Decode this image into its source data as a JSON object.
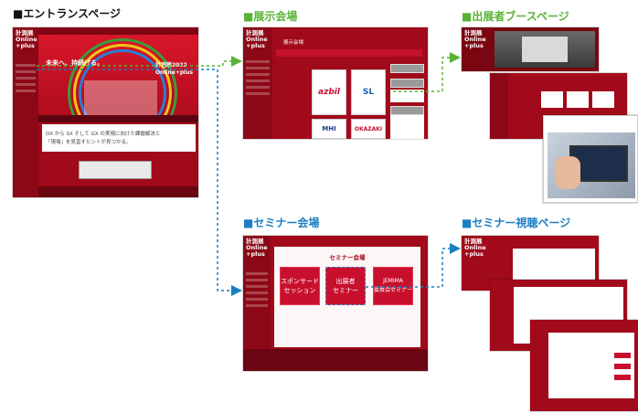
{
  "titles": {
    "entrance": "■エントランスページ",
    "exhibition": "■展示会場",
    "booth": "■出展者ブースページ",
    "seminar": "■セミナー会場",
    "viewing": "■セミナー視聴ページ"
  },
  "entrance": {
    "logo": "計測展\nOnline\n+plus",
    "hero_text": "未来へ、持続げる。",
    "hero_brand": "計測展2022\nOnline+plus",
    "body_line1": "DX から SX そして GX の実現に向けた課題解決と",
    "body_line2": "「現場」を見直すヒントが見つかる。"
  },
  "exhibition": {
    "logo": "計測展\nOnline\n+plus",
    "heading": "展示会場",
    "booths": [
      "azbil",
      "SL",
      "MHI",
      "OKAZAKI"
    ]
  },
  "booth_page": {
    "logo": "計測展\nOnline\n+plus"
  },
  "seminar": {
    "logo": "計測展\nOnline\n+plus",
    "heading": "セミナー会場",
    "buttons": [
      "スポンサード\nセッション",
      "出展者\nセミナー",
      "JEMIMA\n委員会セミナー"
    ]
  },
  "viewing": {
    "logo": "計測展\nOnline\n+plus"
  },
  "colors": {
    "brand_red": "#a10a1a",
    "green": "#58b233",
    "blue": "#1a7ec2"
  }
}
